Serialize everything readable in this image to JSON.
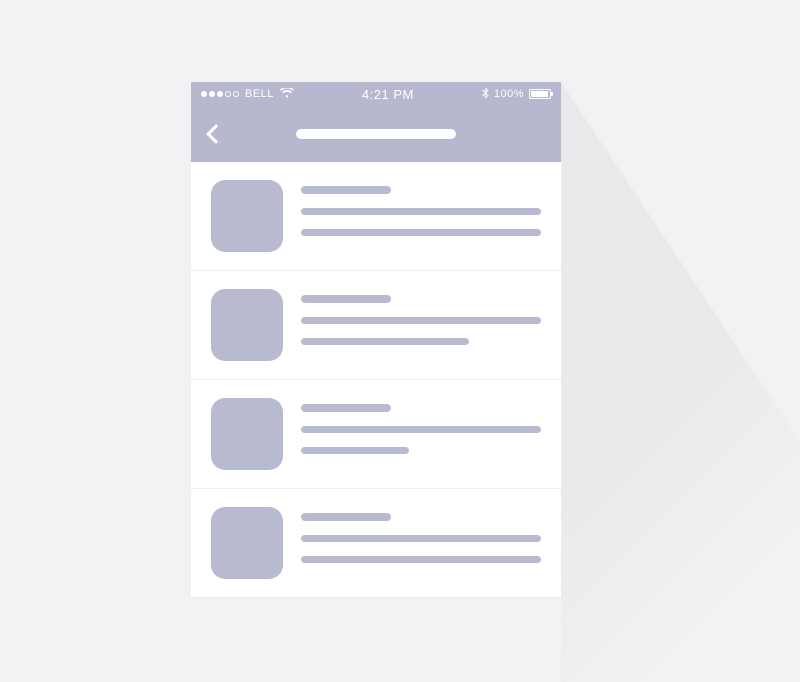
{
  "status_bar": {
    "carrier": "BELL",
    "time": "4:21 PM",
    "battery_pct": "100%"
  },
  "nav": {
    "back_label": "Back"
  },
  "list": {
    "items": [
      {
        "line2_variant": "full"
      },
      {
        "line2_variant": "med"
      },
      {
        "line2_variant": "short"
      }
    ]
  },
  "colors": {
    "chrome": "#b5b8ce",
    "placeholder": "#b8bbd0",
    "page_bg": "#f2f2f4"
  }
}
